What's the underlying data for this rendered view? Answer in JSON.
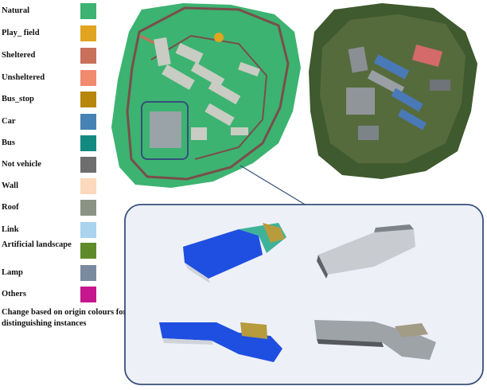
{
  "legend": {
    "items": [
      {
        "label": "Natural",
        "color": "#3cb371"
      },
      {
        "label": "Play_ field",
        "color": "#e0a420"
      },
      {
        "label": "Sheltered",
        "color": "#c8705a"
      },
      {
        "label": "Unsheltered",
        "color": "#f28a6e"
      },
      {
        "label": "Bus_stop",
        "color": "#b8860b"
      },
      {
        "label": "Car",
        "color": "#4682b4"
      },
      {
        "label": "Bus",
        "color": "#138a80"
      },
      {
        "label": "Not vehicle",
        "color": "#6e6e6e"
      },
      {
        "label": "Wall",
        "color": "#fcd8bc"
      },
      {
        "label": "Roof",
        "color": "#8c9385"
      },
      {
        "label": "Link",
        "color": "#a9d3ef"
      },
      {
        "label": "Artificial landscape",
        "color": "#5f8b2a"
      },
      {
        "label": "Lamp",
        "color": "#7a8a9e"
      },
      {
        "label": "Others",
        "color": "#c7178e"
      }
    ],
    "note": "Change based on origin colours for distinguishing instances"
  },
  "colors": {
    "natural": "#3cb371",
    "road": "#7a4e4a",
    "building": "#c9ccc2",
    "highlight_box": "#35507a",
    "panel_fill": "#eef0f8",
    "roof_blue": "#1f4fe0",
    "roof_gold": "#b79b3c"
  }
}
